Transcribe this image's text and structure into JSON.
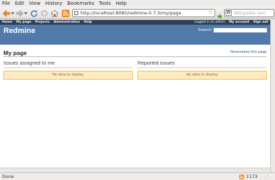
{
  "browser": {
    "menu": [
      "File",
      "Edit",
      "View",
      "History",
      "Bookmarks",
      "Tools",
      "Help"
    ],
    "url": "http://localhost:8080/redmine-0.7.3/my/page",
    "search_placeholder": "Wikipedia (en)",
    "search_engine_icon": "W",
    "status": "Done",
    "status_count": "1173"
  },
  "redmine": {
    "topmenu": [
      "Home",
      "My page",
      "Projects",
      "Administration",
      "Help"
    ],
    "logged_as": "Logged in as admin",
    "account": "My account",
    "signout": "Sign out",
    "title": "Redmine",
    "search_label": "Search:",
    "page_title": "My page",
    "personalize": "Personalize this page",
    "boxes": [
      {
        "title": "Issues assigned to me",
        "empty": "No data to display"
      },
      {
        "title": "Reported issues",
        "empty": "No data to display"
      }
    ]
  },
  "colors": {
    "header": "#507aaa",
    "topmenu": "#2c4056",
    "nodata_bg": "#ffebc1",
    "nodata_border": "#fdbd3b"
  }
}
